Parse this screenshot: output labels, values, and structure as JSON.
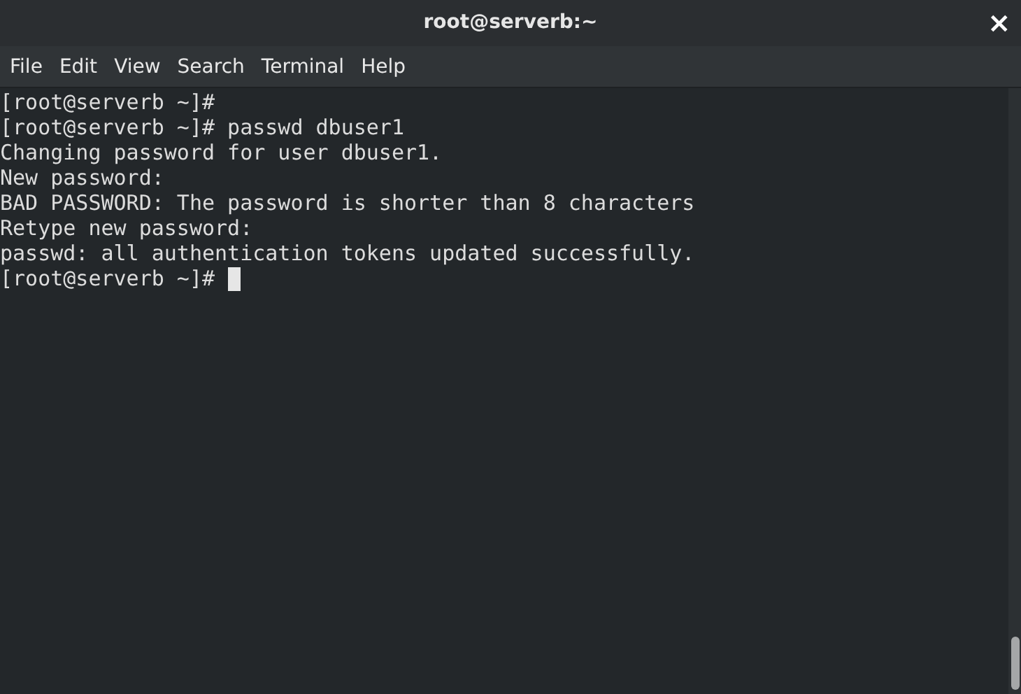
{
  "window": {
    "title": "root@serverb:~",
    "close_label": "×"
  },
  "menu": [
    "File",
    "Edit",
    "View",
    "Search",
    "Terminal",
    "Help"
  ],
  "terminal": {
    "lines": [
      {
        "text": "[root@serverb ~]#",
        "cursor": false
      },
      {
        "text": "[root@serverb ~]# passwd dbuser1",
        "cursor": false
      },
      {
        "text": "Changing password for user dbuser1.",
        "cursor": false
      },
      {
        "text": "New password:",
        "cursor": false
      },
      {
        "text": "BAD PASSWORD: The password is shorter than 8 characters",
        "cursor": false
      },
      {
        "text": "Retype new password:",
        "cursor": false
      },
      {
        "text": "passwd: all authentication tokens updated successfully.",
        "cursor": false
      },
      {
        "text": "[root@serverb ~]#",
        "cursor": true
      }
    ]
  }
}
